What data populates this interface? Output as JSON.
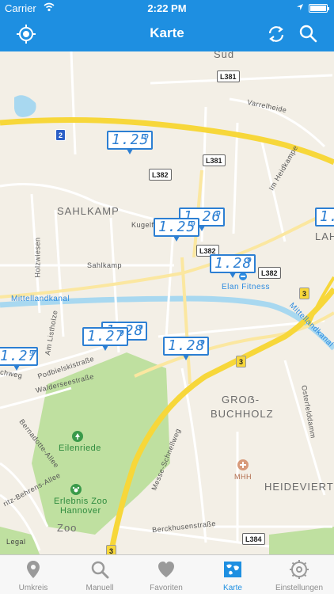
{
  "status": {
    "carrier": "Carrier",
    "time": "2:22 PM"
  },
  "nav": {
    "title": "Karte"
  },
  "map": {
    "areas": {
      "sud": "Süd",
      "sahlkamp": "SAHLKAMP",
      "lah": "LAH",
      "gross_buchholz_1": "GROẞ-",
      "gross_buchholz_2": "BUCHHOLZ",
      "heideviertel": "HEIDEVIERTEL",
      "zoo": "Zoo"
    },
    "streets": {
      "varrelheide": "Varrelheide",
      "im_heidkampe": "Im Heidkampe",
      "kugelfang": "Kugelf",
      "sahlkamp_str": "Sahlkamp",
      "holzwiesen": "Holzwiesen",
      "mittellandkanal": "Mittellandkanal",
      "mittellandkanal_2": "Mittellandkanal",
      "am_listholze": "Am Listholze",
      "podbielskistrasse": "Podbielskistraße",
      "walderseestrasse": "Walderseestraße",
      "schweg": "chweg",
      "messe_schnellweg": "Messe-Schnellweg",
      "osterfelddamm": "Osterfelddamm",
      "bernadotte_allee": "Bernadotte-Allee",
      "fritz_behrens_allee": "ritz-Behrens-Allee",
      "berckhusenstrasse": "Berckhusenstraße"
    },
    "shields": {
      "l381_top": "L381",
      "two": "2",
      "l381_mid": "L381",
      "l382_a": "L382",
      "l382_b": "L382",
      "l382_c": "L382",
      "three_a": "3",
      "three_b": "3",
      "three_c": "3",
      "l384": "L384"
    },
    "pois": {
      "elan_fitness": "Elan Fitness",
      "eilenriede": "Eilenriede",
      "zoo_name_1": "Erlebnis Zoo",
      "zoo_name_2": "Hannover",
      "mhh": "MHH",
      "legal": "Legal"
    },
    "prices": [
      {
        "price": "1.25",
        "frac": "9"
      },
      {
        "price": "1.26",
        "frac": "9"
      },
      {
        "price": "1.25",
        "frac": "9"
      },
      {
        "price": "1.28",
        "frac": "9"
      },
      {
        "price": "1.",
        "frac": ""
      },
      {
        "price": "1.27",
        "frac": "9"
      },
      {
        "price": "1.27",
        "frac": "9"
      },
      {
        "price": "1.28",
        "frac": "9"
      },
      {
        "price": "1.28",
        "frac": "9"
      }
    ]
  },
  "tabs": [
    {
      "label": "Umkreis",
      "icon": "location-pin-icon"
    },
    {
      "label": "Manuell",
      "icon": "search-icon"
    },
    {
      "label": "Favoriten",
      "icon": "heart-icon"
    },
    {
      "label": "Karte",
      "icon": "map-icon",
      "active": true
    },
    {
      "label": "Einstellungen",
      "icon": "gear-icon"
    }
  ],
  "colors": {
    "accent": "#1e8fe1",
    "pin": "#2c7fd3",
    "motorway": "#f7d73a",
    "water": "#a8d8f0",
    "park": "#bfe0a0"
  }
}
